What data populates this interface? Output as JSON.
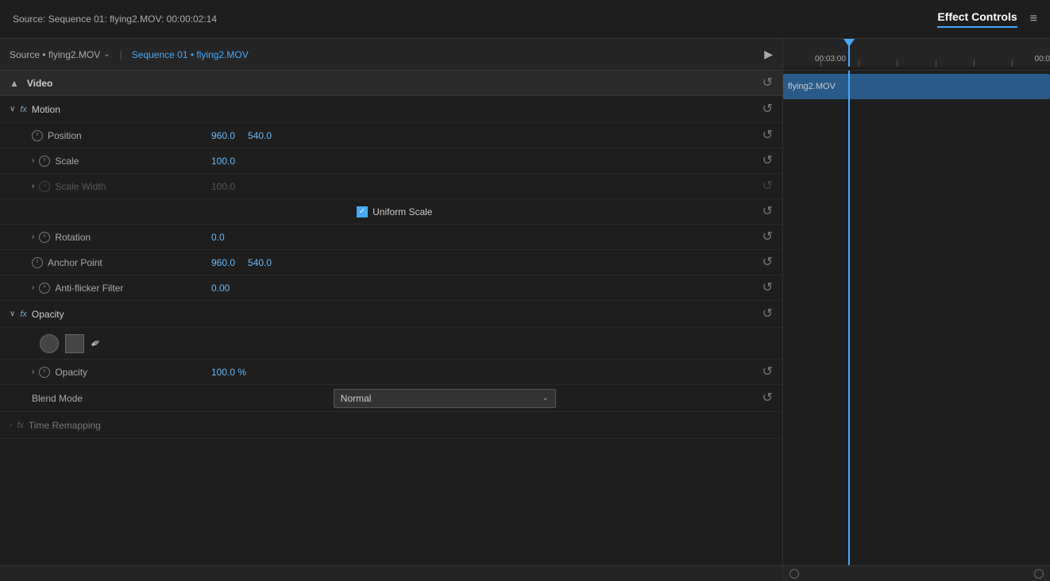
{
  "header": {
    "source_label": "Source: Sequence 01: flying2.MOV: 00:00:02:14",
    "tab_label": "Effect Controls",
    "menu_icon": "≡"
  },
  "source_row": {
    "source_tab": "Source • flying2.MOV",
    "chevron": "⌄",
    "sequence_tab": "Sequence 01 • flying2.MOV",
    "play_icon": "▶"
  },
  "video_section": {
    "title": "Video",
    "collapse": "▲"
  },
  "motion": {
    "name": "Motion",
    "fx": "fx",
    "properties": {
      "position": {
        "label": "Position",
        "x": "960.0",
        "y": "540.0"
      },
      "scale": {
        "label": "Scale",
        "value": "100.0"
      },
      "scale_width": {
        "label": "Scale Width",
        "value": "100.0"
      },
      "uniform_scale": {
        "label": "Uniform Scale"
      },
      "rotation": {
        "label": "Rotation",
        "value": "0.0"
      },
      "anchor_point": {
        "label": "Anchor Point",
        "x": "960.0",
        "y": "540.0"
      },
      "anti_flicker": {
        "label": "Anti-flicker Filter",
        "value": "0.00"
      }
    }
  },
  "opacity": {
    "name": "Opacity",
    "fx": "fx",
    "properties": {
      "opacity": {
        "label": "Opacity",
        "value": "100.0 %"
      },
      "blend_mode": {
        "label": "Blend Mode",
        "value": "Normal"
      }
    }
  },
  "time_remapping": {
    "name": "Time Remapping",
    "fx": "fx"
  },
  "timeline": {
    "clip_label": "flying2.MOV",
    "ruler_label1": "00:03:00",
    "ruler_label2": "00:0"
  },
  "scrollbar": {
    "circle1": "○",
    "circle2": "○"
  }
}
